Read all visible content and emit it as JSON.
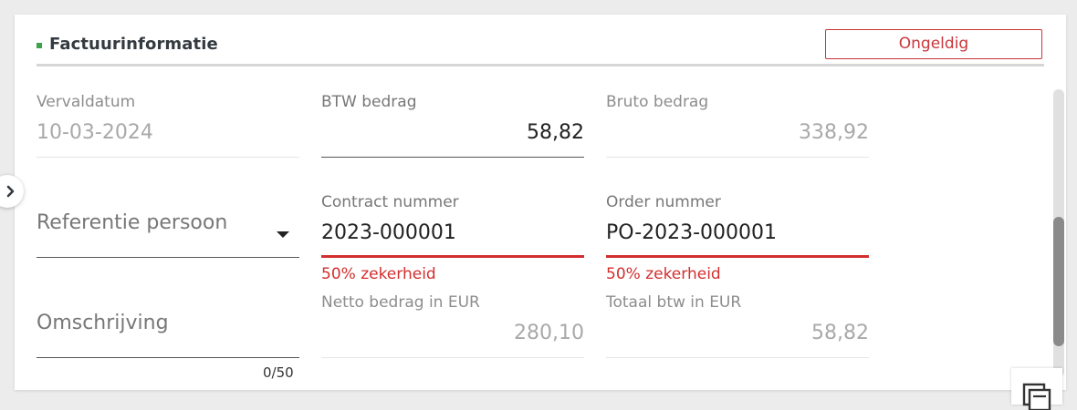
{
  "section": {
    "title": "Factuurinformatie",
    "status_label": "Ongeldig"
  },
  "fields": {
    "vervaldatum": {
      "label": "Vervaldatum",
      "value": "10-03-2024"
    },
    "btw_bedrag": {
      "label": "BTW bedrag",
      "value": "58,82"
    },
    "bruto_bedrag": {
      "label": "Bruto bedrag",
      "value": "338,92"
    },
    "referentie_persoon": {
      "placeholder": "Referentie persoon"
    },
    "contract_nummer": {
      "label": "Contract nummer",
      "value": "2023-000001",
      "helper": "50% zekerheid"
    },
    "order_nummer": {
      "label": "Order nummer",
      "value": "PO-2023-000001",
      "helper": "50% zekerheid"
    },
    "omschrijving": {
      "placeholder": "Omschrijving",
      "counter": "0/50"
    },
    "netto_bedrag": {
      "label": "Netto bedrag in EUR",
      "value": "280,10"
    },
    "totaal_btw": {
      "label": "Totaal btw in EUR",
      "value": "58,82"
    }
  },
  "colors": {
    "accent_green": "#3da34a",
    "error_red": "#d32f2f",
    "status_red": "#c8363b"
  },
  "icons": {
    "side_toggle": "chevron-right-icon",
    "dropdown": "caret-down-icon",
    "corner": "copy-icon"
  }
}
